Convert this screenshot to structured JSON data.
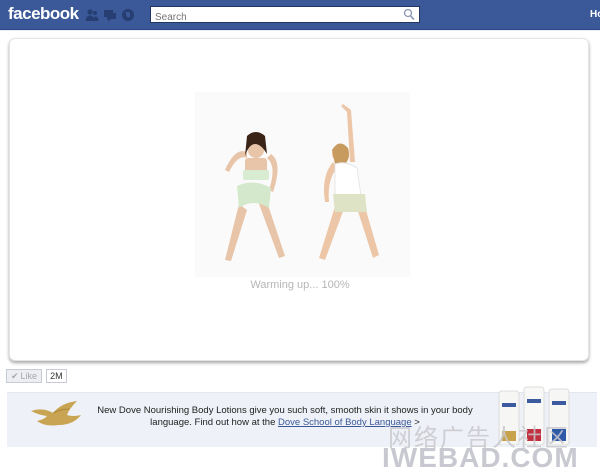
{
  "topbar": {
    "logo": "facebook",
    "search_placeholder": "Search",
    "home_label": "Home"
  },
  "stage": {
    "loading_text": "Warming up... 100%",
    "loading_progress_percent": 100
  },
  "like": {
    "label": "Like",
    "count": "2M"
  },
  "banner": {
    "text_before": "New Dove Nourishing Body Lotions give you such soft, smooth skin it shows in your body language. Find out how at the ",
    "link": "Dove School of Body Language",
    "text_after": " >"
  },
  "watermark": {
    "cn": "网络广告人社区",
    "en": "IWEBAD.COM"
  },
  "colors": {
    "facebook_blue": "#3b5998",
    "link": "#3b5998",
    "loading_text": "#b6b6b6"
  }
}
